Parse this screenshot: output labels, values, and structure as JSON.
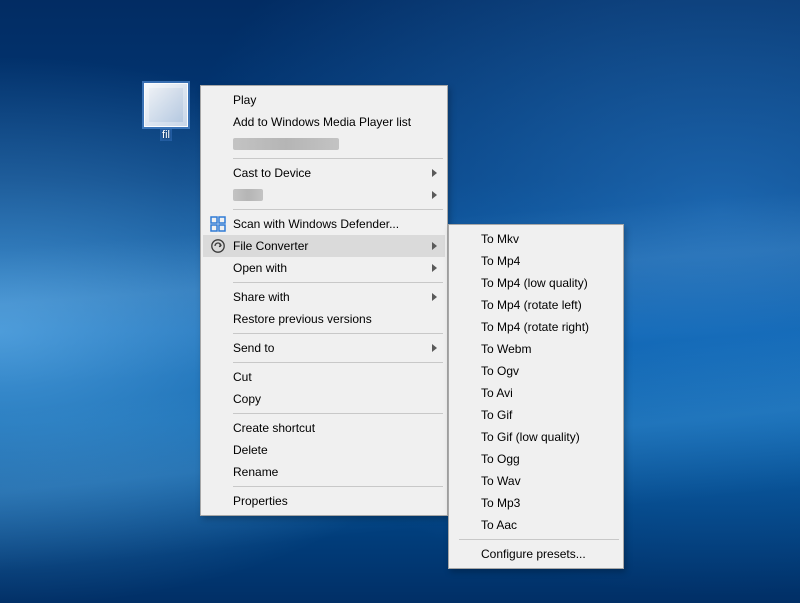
{
  "desktop": {
    "selected_file_label": "fil"
  },
  "context_menu": {
    "play": "Play",
    "add_wmp": "Add to Windows Media Player list",
    "cast": "Cast to Device",
    "scan_defender": "Scan with Windows Defender...",
    "file_converter": "File Converter",
    "open_with": "Open with",
    "share_with": "Share with",
    "restore_prev": "Restore previous versions",
    "send_to": "Send to",
    "cut": "Cut",
    "copy": "Copy",
    "create_shortcut": "Create shortcut",
    "delete": "Delete",
    "rename": "Rename",
    "properties": "Properties"
  },
  "file_converter_submenu": {
    "to_mkv": "To Mkv",
    "to_mp4": "To Mp4",
    "to_mp4_low": "To Mp4 (low quality)",
    "to_mp4_rot_left": "To Mp4 (rotate left)",
    "to_mp4_rot_right": "To Mp4 (rotate right)",
    "to_webm": "To Webm",
    "to_ogv": "To Ogv",
    "to_avi": "To Avi",
    "to_gif": "To Gif",
    "to_gif_low": "To Gif (low quality)",
    "to_ogg": "To Ogg",
    "to_wav": "To Wav",
    "to_mp3": "To Mp3",
    "to_aac": "To Aac",
    "configure": "Configure presets..."
  },
  "icons": {
    "defender": "windows-defender-icon",
    "file_converter": "file-converter-icon",
    "submenu_arrow": "chevron-right-icon"
  },
  "colors": {
    "menu_bg": "#f0f0f0",
    "menu_border": "#a7a7a7",
    "highlight": "#dadada"
  }
}
